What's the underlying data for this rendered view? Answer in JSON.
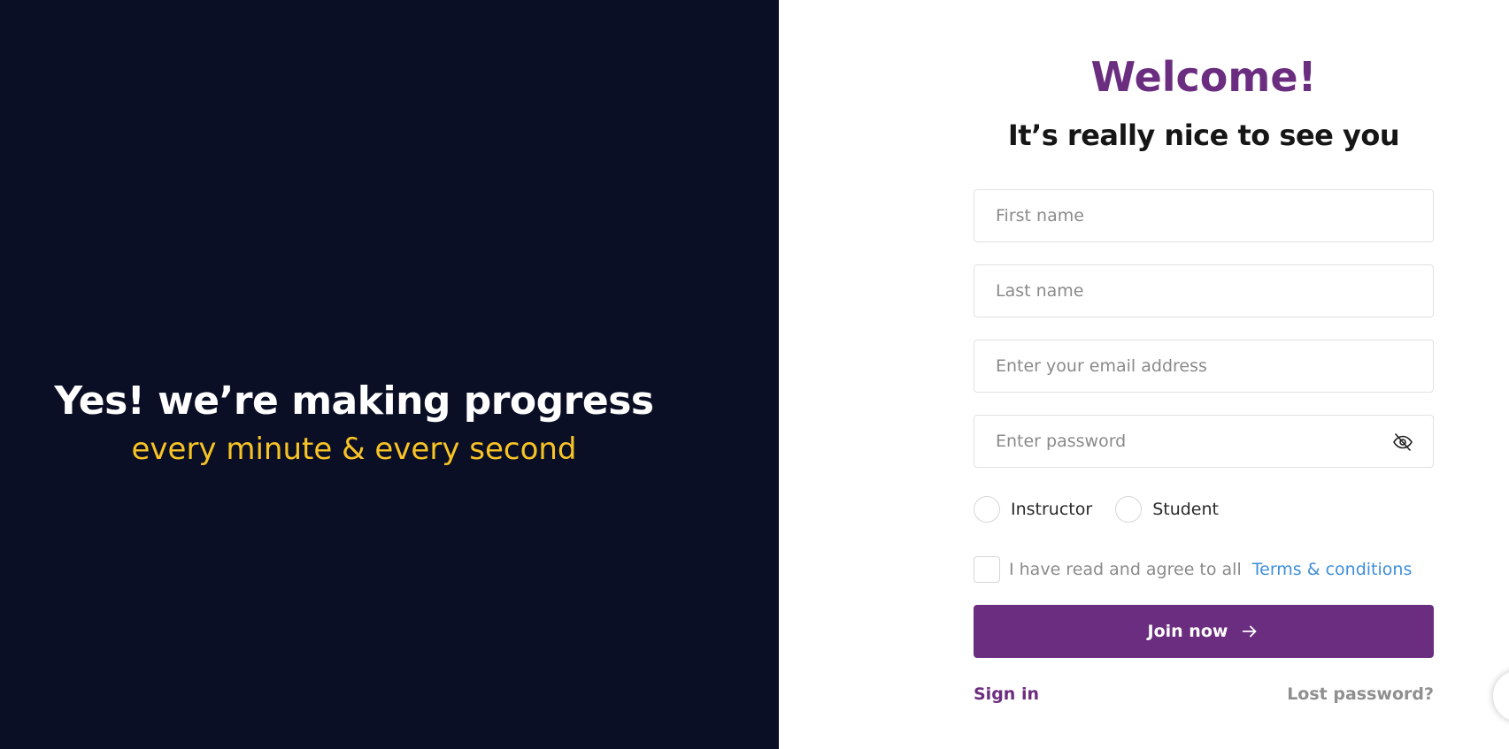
{
  "hero": {
    "title": "Yes! we’re making progress",
    "subtitle": "every minute & every second"
  },
  "form": {
    "welcome": "Welcome!",
    "subtitle": "It’s really nice to see you",
    "first_name_placeholder": "First name",
    "last_name_placeholder": "Last name",
    "email_placeholder": "Enter your email address",
    "password_placeholder": "Enter password",
    "roles": [
      "Instructor",
      "Student"
    ],
    "terms_text": "I have read and agree to all",
    "terms_link": "Terms & conditions",
    "join_label": "Join now",
    "sign_in_label": "Sign in",
    "lost_password_label": "Lost password?"
  },
  "icons": {
    "password_toggle": "eye-slash-icon",
    "join_arrow": "arrow-right-icon"
  },
  "colors": {
    "left_background": "#0b0f25",
    "accent_purple": "#6b2d7f",
    "accent_yellow": "#f7c325",
    "link_blue": "#3f8ed9"
  }
}
